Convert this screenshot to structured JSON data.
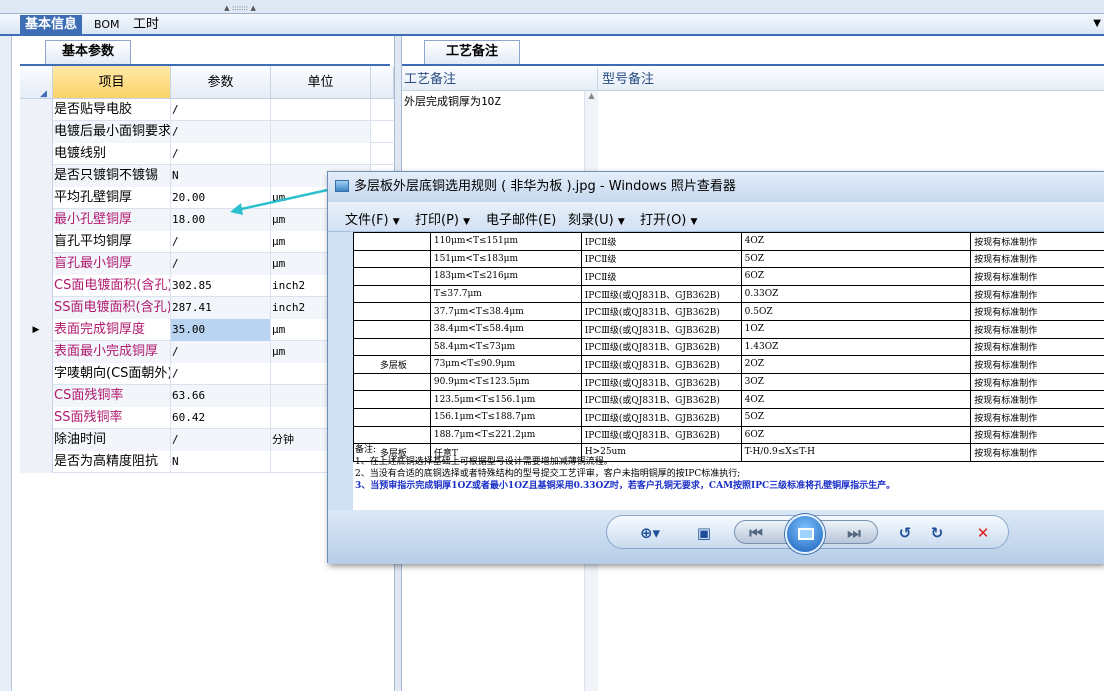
{
  "top_tabs": [
    "基本信息",
    "BOM",
    "工时"
  ],
  "left_subtab": "基本参数",
  "grid": {
    "headers": [
      "项目",
      "参数",
      "单位"
    ],
    "rows": [
      {
        "item": "是否贴导电胶",
        "param": "/",
        "unit": ""
      },
      {
        "item": "电镀后最小面铜要求",
        "param": "/",
        "unit": ""
      },
      {
        "item": "电镀线别",
        "param": "/",
        "unit": ""
      },
      {
        "item": "是否只镀铜不镀锡",
        "param": "N",
        "unit": ""
      },
      {
        "item": "平均孔壁铜厚",
        "param": "20.00",
        "unit": "μm"
      },
      {
        "item": "最小孔壁铜厚",
        "param": "18.00",
        "unit": "μm"
      },
      {
        "item": "盲孔平均铜厚",
        "param": "/",
        "unit": "μm"
      },
      {
        "item": "盲孔最小铜厚",
        "param": "/",
        "unit": "μm"
      },
      {
        "item": "CS面电镀面积(含孔)",
        "param": "302.85",
        "unit": "inch2"
      },
      {
        "item": "SS面电镀面积(含孔)",
        "param": "287.41",
        "unit": "inch2"
      },
      {
        "item": "表面完成铜厚度",
        "param": "35.00",
        "unit": "μm"
      },
      {
        "item": "表面最小完成铜厚",
        "param": "/",
        "unit": "μm"
      },
      {
        "item": "字唛朝向(CS面朝外)",
        "param": "/",
        "unit": ""
      },
      {
        "item": "CS面残铜率",
        "param": "63.66",
        "unit": ""
      },
      {
        "item": "SS面残铜率",
        "param": "60.42",
        "unit": ""
      },
      {
        "item": "除油时间",
        "param": "/",
        "unit": "分钟"
      },
      {
        "item": "是否为高精度阻抗",
        "param": "N",
        "unit": ""
      }
    ]
  },
  "right": {
    "subtab": "工艺备注",
    "col1": "工艺备注",
    "col2": "型号备注",
    "cell1": "外层完成铜厚为1OZ"
  },
  "viewer": {
    "title": "多层板外层底铜选用规则 ( 非华为板 ).jpg - Windows 照片查看器",
    "menu": [
      "文件(F)",
      "打印(P)",
      "电子邮件(E)",
      "刻录(U)",
      "打开(O)"
    ],
    "table": [
      [
        "",
        "110μm<T≤151μm",
        "IPCⅡ级",
        "4OZ",
        "按现有标准制作"
      ],
      [
        "",
        "151μm<T≤183μm",
        "IPCⅡ级",
        "5OZ",
        "按现有标准制作"
      ],
      [
        "",
        "183μm<T≤216μm",
        "IPCⅡ级",
        "6OZ",
        "按现有标准制作"
      ],
      [
        "",
        "T≤37.7μm",
        "IPCⅢ级(或QJ831B、GJB362B)",
        "0.33OZ",
        "按现有标准制作"
      ],
      [
        "",
        "37.7μm<T≤38.4μm",
        "IPCⅢ级(或QJ831B、GJB362B)",
        "0.5OZ",
        "按现有标准制作"
      ],
      [
        "",
        "38.4μm<T≤58.4μm",
        "IPCⅢ级(或QJ831B、GJB362B)",
        "1OZ",
        "按现有标准制作"
      ],
      [
        "",
        "58.4μm<T≤73μm",
        "IPCⅢ级(或QJ831B、GJB362B)",
        "1.43OZ",
        "按现有标准制作"
      ],
      [
        "多层板",
        "73μm<T≤90.9μm",
        "IPCⅢ级(或QJ831B、GJB362B)",
        "2OZ",
        "按现有标准制作"
      ],
      [
        "",
        "90.9μm<T≤123.5μm",
        "IPCⅢ级(或QJ831B、GJB362B)",
        "3OZ",
        "按现有标准制作"
      ],
      [
        "",
        "123.5μm<T≤156.1μm",
        "IPCⅢ级(或QJ831B、GJB362B)",
        "4OZ",
        "按现有标准制作"
      ],
      [
        "",
        "156.1μm<T≤188.7μm",
        "IPCⅢ级(或QJ831B、GJB362B)",
        "5OZ",
        "按现有标准制作"
      ],
      [
        "",
        "188.7μm<T≤221.2μm",
        "IPCⅢ级(或QJ831B、GJB362B)",
        "6OZ",
        "按现有标准制作"
      ],
      [
        "多层板",
        "任意T",
        "H>25um",
        "T-H/0.9≤X≤T-H",
        "按现有标准制作"
      ]
    ],
    "notes": [
      "备注:",
      "1、在上述底铜选择基础上可根据型号设计需要增加减薄铜流程。",
      "2、当没有合适的底铜选择或者特殊结构的型号提交工艺评审，客户未指明铜厚的按IPC标准执行;",
      "3、当预审指示完成铜厚1OZ或者最小1OZ且基铜采用0.33OZ时，若客户孔铜无要求，CAM按照IPC三级标准将孔壁铜厚指示生产。"
    ]
  }
}
